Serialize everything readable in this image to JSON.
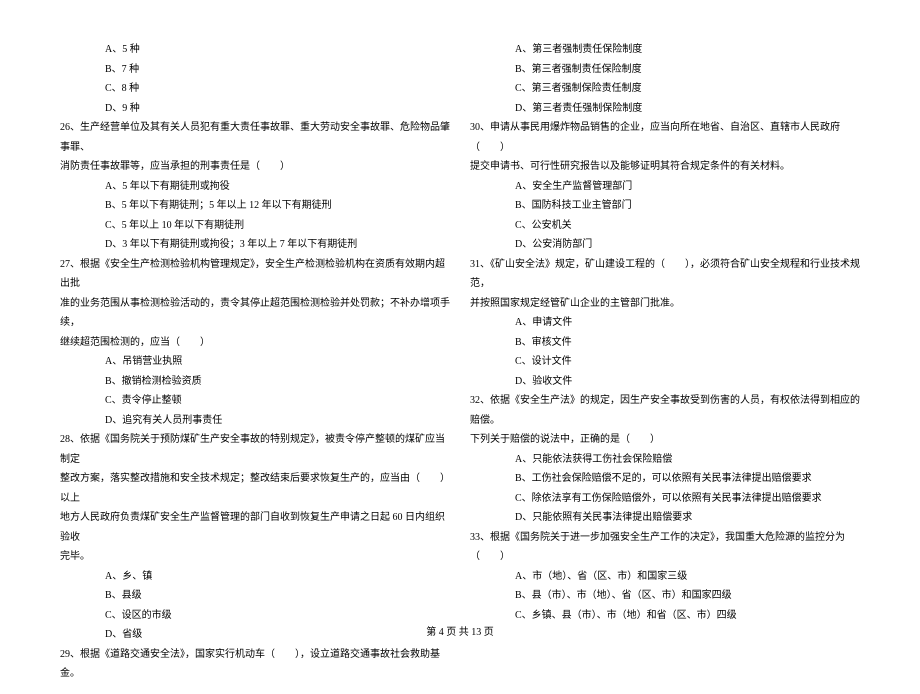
{
  "left": {
    "q25_opts": [
      "A、5 种",
      "B、7 种",
      "C、8 种",
      "D、9 种"
    ],
    "q26": "26、生产经营单位及其有关人员犯有重大责任事故罪、重大劳动安全事故罪、危险物品肇事罪、",
    "q26_cont": "消防责任事故罪等，应当承担的刑事责任是（　　）",
    "q26_opts": [
      "A、5 年以下有期徒刑或拘役",
      "B、5 年以下有期徒刑；5 年以上 12 年以下有期徒刑",
      "C、5 年以上 10 年以下有期徒刑",
      "D、3 年以下有期徒刑或拘役；3 年以上 7 年以下有期徒刑"
    ],
    "q27": "27、根据《安全生产检测检验机构管理规定》，安全生产检测检验机构在资质有效期内超出批",
    "q27_cont1": "准的业务范围从事检测检验活动的，责令其停止超范围检测检验并处罚款；不补办增项手续，",
    "q27_cont2": "继续超范围检测的，应当（　　）",
    "q27_opts": [
      "A、吊销营业执照",
      "B、撤销检测检验资质",
      "C、责令停止整顿",
      "D、追究有关人员刑事责任"
    ],
    "q28": "28、依据《国务院关于预防煤矿生产安全事故的特别规定》，被责令停产整顿的煤矿应当制定",
    "q28_cont1": "整改方案，落实整改措施和安全技术规定；整改结束后要求恢复生产的，应当由（　　）以上",
    "q28_cont2": "地方人民政府负责煤矿安全生产监督管理的部门自收到恢复生产申请之日起 60 日内组织验收",
    "q28_cont3": "完毕。",
    "q28_opts": [
      "A、乡、镇",
      "B、县级",
      "C、设区的市级",
      "D、省级"
    ],
    "q29": "29、根据《道路交通安全法》，国家实行机动车（　　），设立道路交通事故社会救助基金。"
  },
  "right": {
    "q29_opts": [
      "A、第三者强制责任保险制度",
      "B、第三者强制责任保险制度",
      "C、第三者强制保险责任制度",
      "D、第三者责任强制保险制度"
    ],
    "q30": "30、申请从事民用爆炸物品销售的企业，应当向所在地省、自治区、直辖市人民政府（　　）",
    "q30_cont": "提交申请书、可行性研究报告以及能够证明其符合规定条件的有关材料。",
    "q30_opts": [
      "A、安全生产监督管理部门",
      "B、国防科技工业主管部门",
      "C、公安机关",
      "D、公安消防部门"
    ],
    "q31": "31、《矿山安全法》规定，矿山建设工程的（　　），必须符合矿山安全规程和行业技术规范，",
    "q31_cont": "并按照国家规定经管矿山企业的主管部门批准。",
    "q31_opts": [
      "A、申请文件",
      "B、审核文件",
      "C、设计文件",
      "D、验收文件"
    ],
    "q32": "32、依据《安全生产法》的规定，因生产安全事故受到伤害的人员，有权依法得到相应的赔偿。",
    "q32_cont": "下列关于赔偿的说法中，正确的是（　　）",
    "q32_opts": [
      "A、只能依法获得工伤社会保险赔偿",
      "B、工伤社会保险赔偿不足的，可以依照有关民事法律提出赔偿要求",
      "C、除依法享有工伤保险赔偿外，可以依照有关民事法律提出赔偿要求",
      "D、只能依照有关民事法律提出赔偿要求"
    ],
    "q33": "33、根据《国务院关于进一步加强安全生产工作的决定》，我国重大危险源的监控分为（　　）",
    "q33_opts": [
      "A、市（地）、省（区、市）和国家三级",
      "B、县（市）、市（地）、省（区、市）和国家四级",
      "C、乡镇、县（市）、市（地）和省（区、市）四级"
    ]
  },
  "footer": "第 4 页 共 13 页"
}
